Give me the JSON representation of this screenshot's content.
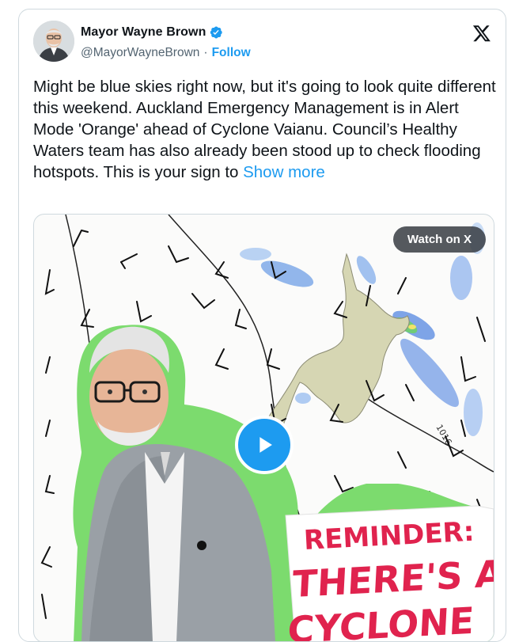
{
  "author": {
    "name": "Mayor Wayne Brown",
    "handle": "@MayorWayneBrown",
    "separator": "·",
    "follow_label": "Follow"
  },
  "tweet": {
    "text": "Might be blue skies right now, but it's going to look quite different this weekend. Auckland Emergency Management is in Alert Mode 'Orange' ahead of Cyclone Vaianu. Council’s Healthy Waters team has also already been stood up to check flooding hotspots. This is your sign to ",
    "show_more_label": "Show more"
  },
  "media": {
    "watch_label": "Watch on X",
    "isobar_label": "1016",
    "sign_line1": "REMINDER:",
    "sign_line2": "THERE'S A",
    "sign_line3": "CYCLONE"
  },
  "icons": {
    "verified": "verified-badge-icon",
    "brand": "x-logo-icon",
    "play": "play-icon"
  },
  "colors": {
    "accent": "#1d9bf0",
    "text": "#0f1419",
    "muted": "#536471",
    "sign_red": "#e0234e",
    "outline_green": "#7cdb6e"
  }
}
